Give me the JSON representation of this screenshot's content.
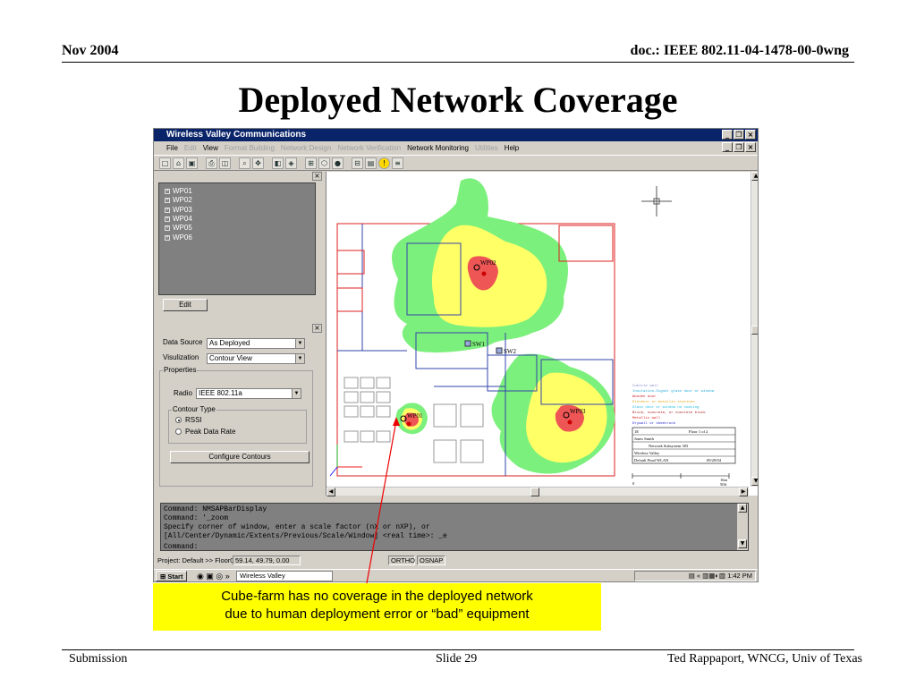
{
  "slide": {
    "header_left": "Nov 2004",
    "header_right": "doc.: IEEE 802.11-04-1478-00-0wng",
    "title": "Deployed Network Coverage",
    "footer_left": "Submission",
    "footer_center": "Slide 29",
    "footer_right": "Ted Rappaport, WNCG, Univ of Texas"
  },
  "app": {
    "title": "Wireless Valley Communications",
    "menu": [
      {
        "label": "File",
        "enabled": true
      },
      {
        "label": "Edit",
        "enabled": false
      },
      {
        "label": "View",
        "enabled": true
      },
      {
        "label": "Format Building",
        "enabled": false
      },
      {
        "label": "Network Design",
        "enabled": false
      },
      {
        "label": "Network Verification",
        "enabled": false
      },
      {
        "label": "Network Monitoring",
        "enabled": true
      },
      {
        "label": "Utilities",
        "enabled": false
      },
      {
        "label": "Help",
        "enabled": true
      }
    ],
    "tree_items": [
      "WP01",
      "WP02",
      "WP03",
      "WP04",
      "WP05",
      "WP06"
    ],
    "edit_button": "Edit",
    "props": {
      "data_source_label": "Data Source",
      "data_source_value": "As Deployed",
      "visualization_label": "Visulization",
      "visualization_value": "Contour View",
      "properties_title": "Properties",
      "radio_label": "Radio",
      "radio_value": "IEEE 802.11a",
      "contour_type_title": "Contour Type",
      "option_rssi": "RSSI",
      "option_peak": "Peak Data Rate",
      "configure_button": "Configure Contours"
    },
    "map_labels": {
      "wp01": "WP01",
      "wp02": "WP02",
      "wp03": "WP03",
      "sw1": "SW1",
      "sw2": "SW2"
    },
    "legend_lines": [
      "Cubicle wall",
      "Insulation-Signal glass door or window",
      "Wooden door",
      "Elevator or metallic stations",
      "Glass door or window no coating",
      "Brick, concrete, or concrete block",
      "Metallic wall",
      "Drywall or sheetrock"
    ],
    "title_block": {
      "row1_left": "1E",
      "row1_right": "Floor 1 of 2",
      "row2": "Jones Smith",
      "row3": "Network Subsystem 303",
      "row4": "Wireless Valley",
      "row5_left": "Default Final WLAN",
      "row5_right": "09/29/04"
    },
    "scale": {
      "start": "0",
      "end": "16m",
      "unit": "50ft"
    },
    "commands": [
      "Command: NMSAPBarDisplay",
      "Command: '_zoom",
      "Specify corner of window, enter a scale factor (nX or nXP), or",
      "[All/Center/Dynamic/Extents/Previous/Scale/Window] <real time>: _e",
      "",
      "Command:"
    ],
    "status": {
      "project": "Project: Default >> Floor01",
      "coords": "59.14, 49.79, 0.00",
      "ortho": "ORTHO",
      "osnap": "OSNAP"
    },
    "taskbar": {
      "start": "Start",
      "task": "Wireless Valley",
      "clock": "1:42 PM"
    }
  },
  "callout": {
    "line1": "Cube-farm has no coverage in the deployed network",
    "line2": "due to human deployment error or “bad” equipment"
  },
  "colors": {
    "coverage_green": "#7cf07c",
    "coverage_yellow": "#ffff66",
    "coverage_red": "#ee5555",
    "callout": "#ffff00",
    "titlebar": "#0a246a"
  }
}
